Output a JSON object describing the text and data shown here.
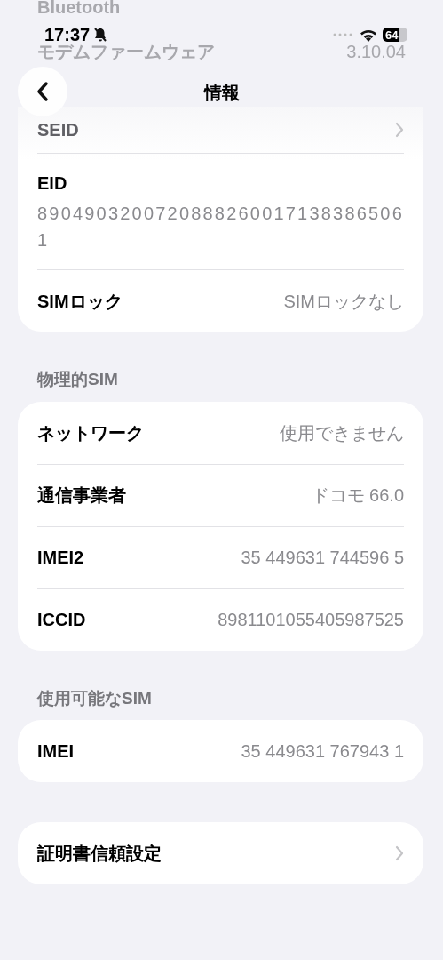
{
  "status_bar": {
    "time": "17:37",
    "battery": "64"
  },
  "background_rows": [
    {
      "label": "Bluetooth"
    },
    {
      "label": "モデムファームウェア",
      "value": "3.10.04"
    }
  ],
  "nav": {
    "title": "情報"
  },
  "sections": [
    {
      "rows": [
        {
          "kind": "chevron",
          "label": "SEID",
          "faded": true
        },
        {
          "kind": "stacked",
          "label": "EID",
          "value": "89049032007208882600171383865061"
        },
        {
          "kind": "value",
          "label": "SIMロック",
          "value": "SIMロックなし"
        }
      ]
    },
    {
      "header": "物理的SIM",
      "rows": [
        {
          "kind": "value",
          "label": "ネットワーク",
          "value": "使用できません"
        },
        {
          "kind": "value",
          "label": "通信事業者",
          "value": "ドコモ 66.0"
        },
        {
          "kind": "value",
          "label": "IMEI2",
          "value": "35 449631 744596 5"
        },
        {
          "kind": "value",
          "label": "ICCID",
          "value": "8981101055405987525"
        }
      ]
    },
    {
      "header": "使用可能なSIM",
      "rows": [
        {
          "kind": "value",
          "label": "IMEI",
          "value": "35 449631 767943 1"
        }
      ]
    },
    {
      "rows": [
        {
          "kind": "chevron",
          "label": "証明書信頼設定"
        }
      ]
    }
  ]
}
